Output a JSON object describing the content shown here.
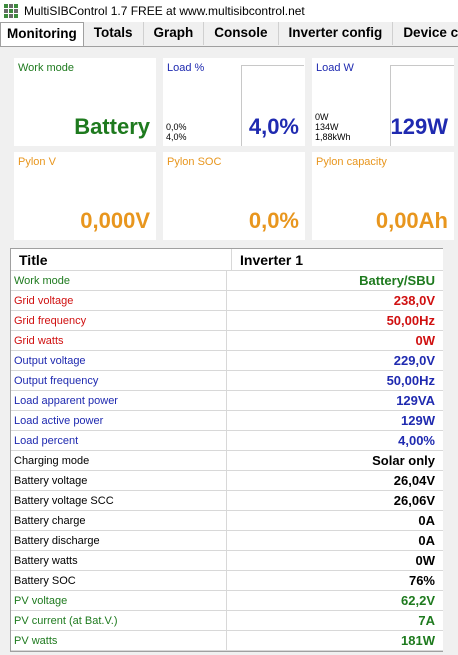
{
  "window": {
    "title": "MultiSIBControl 1.7 FREE at www.multisibcontrol.net"
  },
  "tabs": [
    {
      "label": "Monitoring"
    },
    {
      "label": "Totals"
    },
    {
      "label": "Graph"
    },
    {
      "label": "Console"
    },
    {
      "label": "Inverter config"
    },
    {
      "label": "Device c"
    }
  ],
  "cards": {
    "work_mode": {
      "label": "Work mode",
      "value": "Battery",
      "color": "#1e7a1e"
    },
    "load_pct": {
      "label": "Load %",
      "value": "4,0%",
      "lines": [
        "0,0%",
        "4,0%"
      ],
      "color": "#1f2ab0"
    },
    "load_w": {
      "label": "Load W",
      "value": "129W",
      "lines": [
        "0W",
        "134W",
        "1,88kWh"
      ],
      "color": "#1f2ab0"
    },
    "pylon_v": {
      "label": "Pylon V",
      "value": "0,000V",
      "color": "#e8961e"
    },
    "pylon_soc": {
      "label": "Pylon SOC",
      "value": "0,0%",
      "color": "#e8961e"
    },
    "pylon_cap": {
      "label": "Pylon capacity",
      "value": "0,00Ah",
      "color": "#e8961e"
    }
  },
  "table": {
    "headers": [
      "Title",
      "Inverter 1"
    ],
    "rows": [
      {
        "title": "Work mode",
        "value": "Battery/SBU",
        "color": "#1e7a1e"
      },
      {
        "title": "Grid voltage",
        "value": "238,0V",
        "color": "#d01010"
      },
      {
        "title": "Grid frequency",
        "value": "50,00Hz",
        "color": "#d01010"
      },
      {
        "title": "Grid watts",
        "value": "0W",
        "color": "#d01010"
      },
      {
        "title": "Output voltage",
        "value": "229,0V",
        "color": "#1f2ab0"
      },
      {
        "title": "Output frequency",
        "value": "50,00Hz",
        "color": "#1f2ab0"
      },
      {
        "title": "Load apparent power",
        "value": "129VA",
        "color": "#1f2ab0"
      },
      {
        "title": "Load active power",
        "value": "129W",
        "color": "#1f2ab0"
      },
      {
        "title": "Load percent",
        "value": "4,00%",
        "color": "#1f2ab0"
      },
      {
        "title": "Charging mode",
        "value": "Solar only",
        "color": "#000000"
      },
      {
        "title": "Battery voltage",
        "value": "26,04V",
        "color": "#000000"
      },
      {
        "title": "Battery voltage SCC",
        "value": "26,06V",
        "color": "#000000"
      },
      {
        "title": "Battery charge",
        "value": "0A",
        "color": "#000000"
      },
      {
        "title": "Battery discharge",
        "value": "0A",
        "color": "#000000"
      },
      {
        "title": "Battery watts",
        "value": "0W",
        "color": "#000000"
      },
      {
        "title": "Battery SOC",
        "value": "76%",
        "color": "#000000"
      },
      {
        "title": "PV voltage",
        "value": "62,2V",
        "color": "#1e7a1e"
      },
      {
        "title": "PV current (at Bat.V.)",
        "value": "7A",
        "color": "#1e7a1e"
      },
      {
        "title": "PV watts",
        "value": "181W",
        "color": "#1e7a1e"
      }
    ]
  }
}
